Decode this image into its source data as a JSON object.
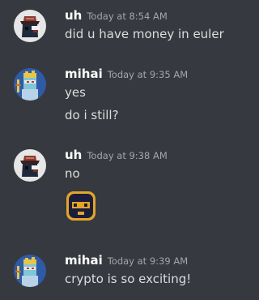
{
  "messages": [
    {
      "author": "uh",
      "avatar_icon": "hat-character-avatar",
      "timestamp": "Today at 8:54 AM",
      "lines": [
        "did u have money in euler"
      ]
    },
    {
      "author": "mihai",
      "avatar_icon": "pixel-face-avatar",
      "timestamp": "Today at 9:35 AM",
      "lines": [
        "yes",
        "do i still?"
      ]
    },
    {
      "author": "uh",
      "avatar_icon": "hat-character-avatar",
      "timestamp": "Today at 9:38 AM",
      "lines": [
        "no"
      ],
      "sticker_icon": "balaclava-emoji"
    },
    {
      "author": "mihai",
      "avatar_icon": "pixel-face-avatar",
      "timestamp": "Today at 9:39 AM",
      "lines": [
        "crypto is so exciting!"
      ]
    }
  ],
  "colors": {
    "background": "#36393f",
    "author": "#ffffff",
    "timestamp": "#a3a6aa",
    "text": "#dcddde",
    "avatar_uh_bg": "#e6e6e6",
    "avatar_mihai_bg": "#2f5aa6"
  }
}
